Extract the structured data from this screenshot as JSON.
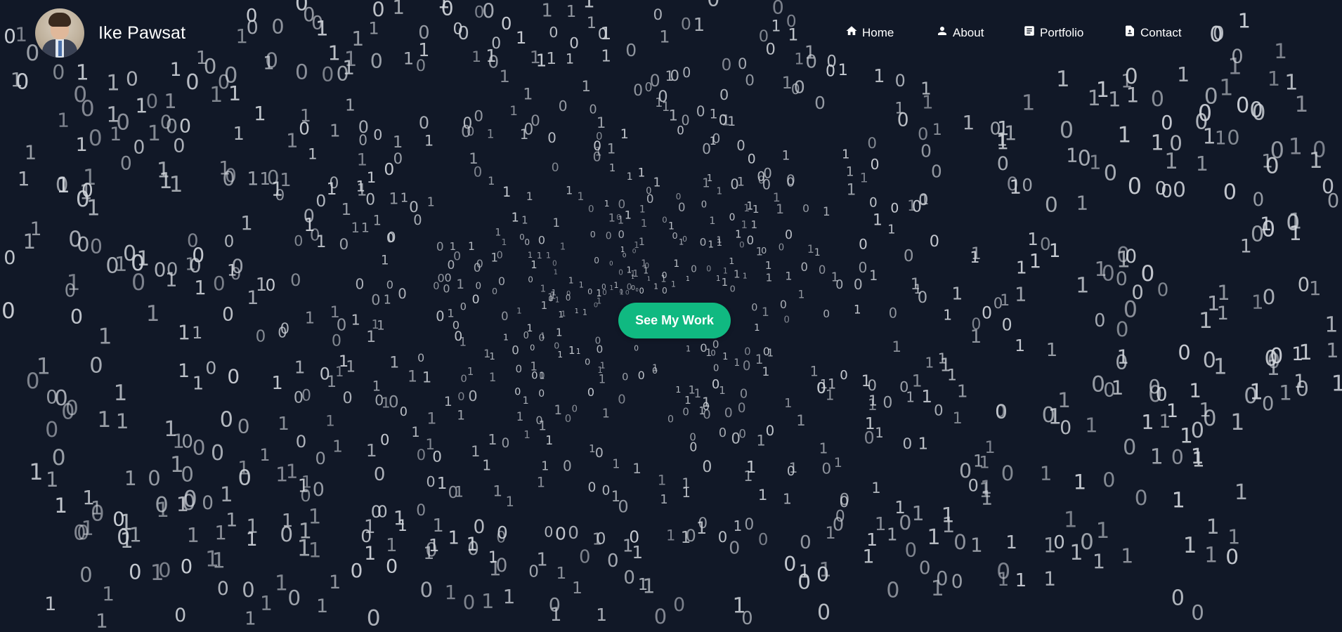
{
  "header": {
    "brand_name": "Ike Pawsat",
    "avatar_icon": "profile-photo",
    "nav": [
      {
        "label": "Home",
        "icon": "home-icon"
      },
      {
        "label": "About",
        "icon": "person-icon"
      },
      {
        "label": "Portfolio",
        "icon": "document-list-icon"
      },
      {
        "label": "Contact",
        "icon": "contact-document-icon"
      }
    ]
  },
  "hero": {
    "cta_label": "See My Work",
    "cta_color": "#10b981"
  },
  "theme": {
    "background": "#111827",
    "digit_color": "#d1d5db"
  }
}
